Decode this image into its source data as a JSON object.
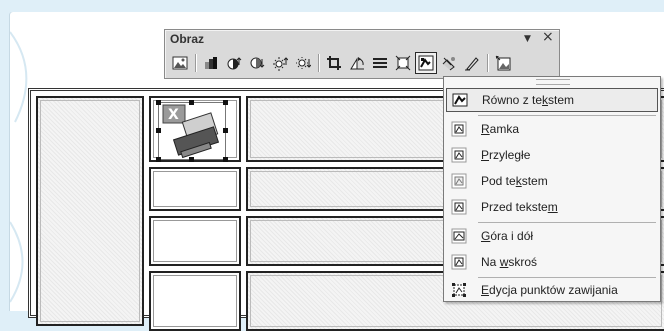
{
  "toolbar": {
    "title": "Obraz",
    "dropdown_arrow": "▼",
    "close": "×",
    "icons": [
      "insert-picture-icon",
      "color-icon",
      "more-contrast-icon",
      "less-contrast-icon",
      "more-brightness-icon",
      "less-brightness-icon",
      "crop-icon",
      "rotate-left-icon",
      "line-style-icon",
      "compress-pictures-icon",
      "text-wrapping-icon",
      "format-picture-icon",
      "set-transparent-color-icon",
      "reset-picture-icon"
    ]
  },
  "menu": {
    "items": [
      {
        "pre": "Równo z te",
        "ul": "k",
        "post": "stem",
        "icon": "wrap-inline-icon",
        "highlighted": true
      },
      {
        "pre": "",
        "ul": "R",
        "post": "amka",
        "icon": "wrap-square-icon"
      },
      {
        "pre": "",
        "ul": "P",
        "post": "rzyległe",
        "icon": "wrap-tight-icon"
      },
      {
        "pre": "Pod te",
        "ul": "k",
        "post": "stem",
        "icon": "wrap-behind-icon"
      },
      {
        "pre": "Przed tekste",
        "ul": "m",
        "post": "",
        "icon": "wrap-front-icon"
      },
      {
        "pre": "",
        "ul": "G",
        "post": "óra i dół",
        "icon": "wrap-top-bottom-icon"
      },
      {
        "pre": "Na ",
        "ul": "w",
        "post": "skroś",
        "icon": "wrap-through-icon"
      },
      {
        "pre": "",
        "ul": "E",
        "post": "dycja punktów zawijania",
        "icon": "edit-wrap-points-icon"
      }
    ]
  }
}
